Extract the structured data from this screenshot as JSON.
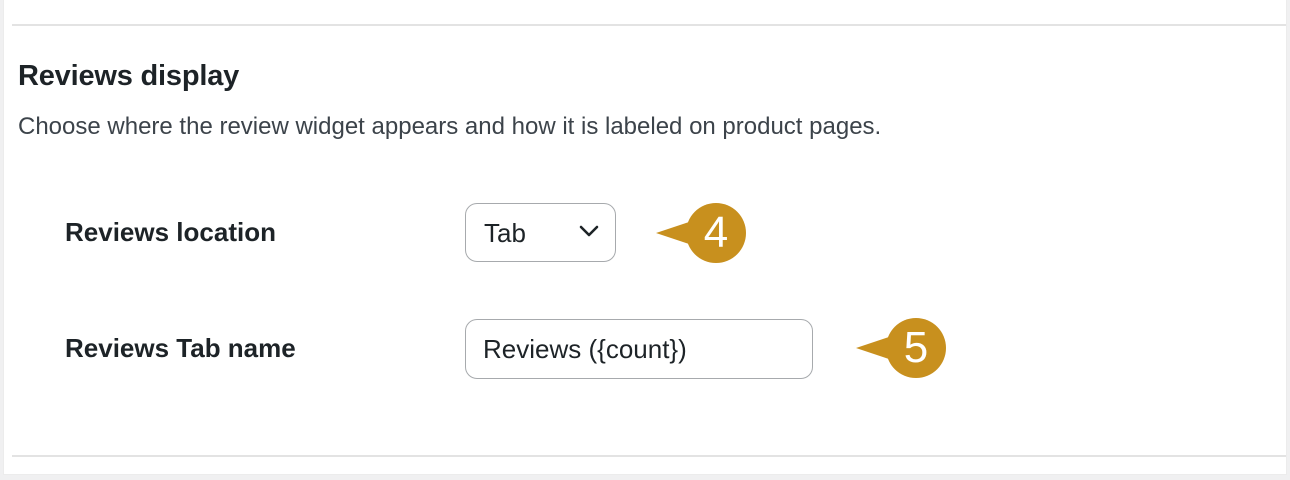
{
  "section": {
    "title": "Reviews display",
    "description": "Choose where the review widget appears and how it is labeled on product pages."
  },
  "fields": {
    "location": {
      "label": "Reviews location",
      "value": "Tab",
      "icon": "chevron-down-icon"
    },
    "tab_name": {
      "label": "Reviews Tab name",
      "value": "Reviews ({count})"
    }
  },
  "callouts": {
    "first": "4",
    "second": "5",
    "color": "#c8901e"
  }
}
